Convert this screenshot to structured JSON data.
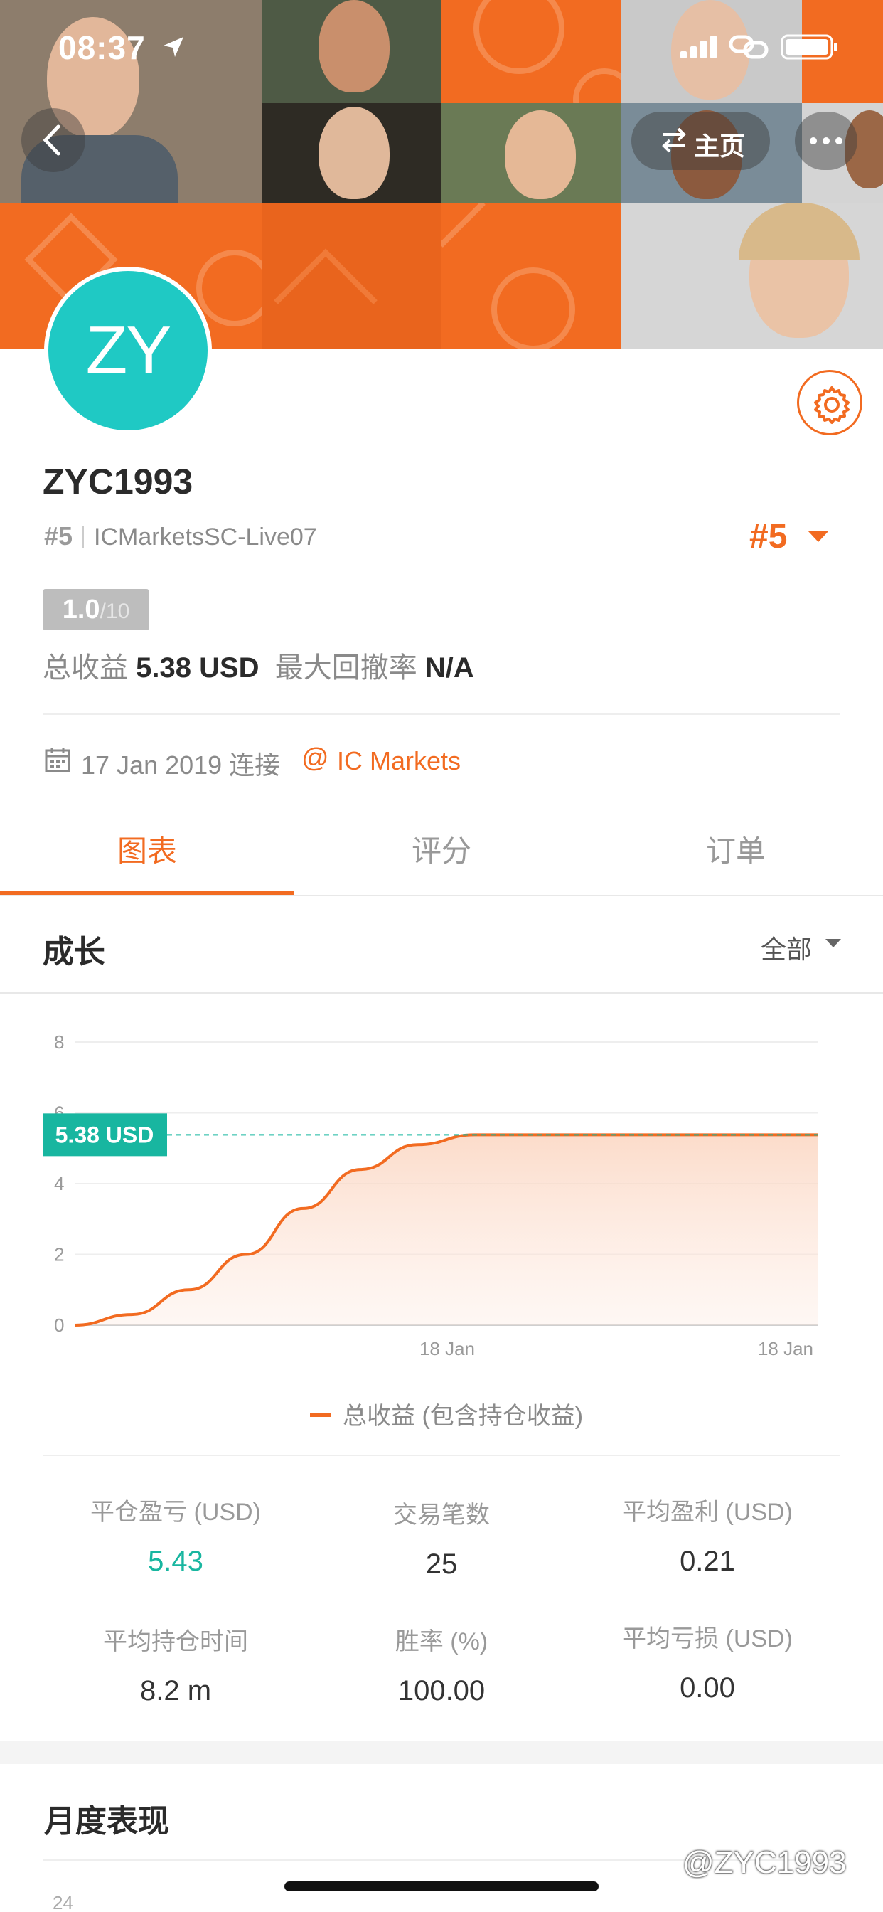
{
  "status_bar": {
    "time": "08:37"
  },
  "header": {
    "home_label": "主页"
  },
  "profile": {
    "initials": "ZY",
    "avatar_color": "#1fc9c4",
    "username": "ZYC1993",
    "rank_small": "#5",
    "server": "ICMarketsSC-Live07",
    "rank_big": "#5",
    "score": "1.0",
    "score_max": "/10",
    "total_profit_label": "总收益",
    "total_profit_value": "5.38 USD",
    "max_drawdown_label": "最大回撤率",
    "max_drawdown_value": "N/A",
    "connected_date": "17 Jan 2019 连接",
    "broker_at": "@",
    "broker": "IC Markets"
  },
  "tabs": [
    {
      "label": "图表",
      "active": true
    },
    {
      "label": "评分",
      "active": false
    },
    {
      "label": "订单",
      "active": false
    }
  ],
  "growth": {
    "title": "成长",
    "filter": "全部",
    "legend": "总收益 (包含持仓收益)"
  },
  "chart_data": {
    "type": "area",
    "x": [
      "",
      "18 Jan",
      "18 Jan"
    ],
    "yticks": [
      0,
      2,
      4,
      6,
      8
    ],
    "ylim": [
      0,
      8
    ],
    "current_value_label": "5.38 USD",
    "series": [
      {
        "name": "总收益 (包含持仓收益)",
        "values": [
          0.0,
          0.3,
          1.0,
          2.0,
          3.3,
          4.4,
          5.1,
          5.38,
          5.38,
          5.38,
          5.38,
          5.38,
          5.38,
          5.38
        ]
      }
    ],
    "line_color": "#f26b21",
    "marker_color": "#18b6a0"
  },
  "stats": [
    {
      "label": "平仓盈亏 (USD)",
      "value": "5.43",
      "highlight": true
    },
    {
      "label": "交易笔数",
      "value": "25",
      "highlight": false
    },
    {
      "label": "平均盈利 (USD)",
      "value": "0.21",
      "highlight": false
    },
    {
      "label": "平均持仓时间",
      "value": "8.2 m",
      "highlight": false
    },
    {
      "label": "胜率 (%)",
      "value": "100.00",
      "highlight": false
    },
    {
      "label": "平均亏损 (USD)",
      "value": "0.00",
      "highlight": false
    }
  ],
  "monthly": {
    "title": "月度表现",
    "first_tick": "24"
  },
  "watermark": "@ZYC1993",
  "colors": {
    "accent": "#f26b21",
    "positive": "#18b6a0"
  }
}
